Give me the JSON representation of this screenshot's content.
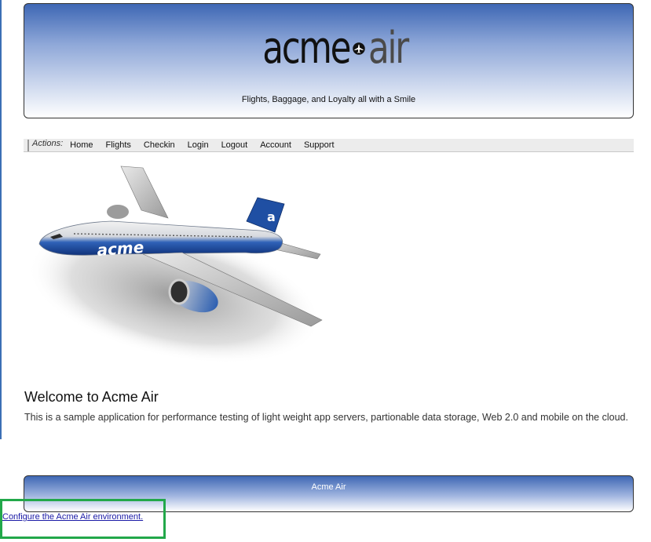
{
  "header": {
    "logo_left": "acme",
    "logo_right": "air",
    "logo_icon": "airplane-icon",
    "tagline": "Flights, Baggage, and Loyalty all with a Smile"
  },
  "nav": {
    "label": "Actions:",
    "items": [
      "Home",
      "Flights",
      "Checkin",
      "Login",
      "Logout",
      "Account",
      "Support"
    ]
  },
  "hero": {
    "image": "airplane-image",
    "fuselage_text": "acme",
    "tail_text": "a"
  },
  "welcome": {
    "title": "Welcome to Acme Air",
    "body": "This is a sample application for performance testing of light weight app servers, partionable data storage, Web 2.0 and mobile on the cloud."
  },
  "footer": {
    "text": "Acme Air"
  },
  "config_link": "Configure the Acme Air environment.",
  "colors": {
    "banner_blue": "#3e67b4",
    "link_blue": "#1a1aa6",
    "highlight_green": "#22a84a",
    "hero_blue": "#1f4fa3"
  }
}
